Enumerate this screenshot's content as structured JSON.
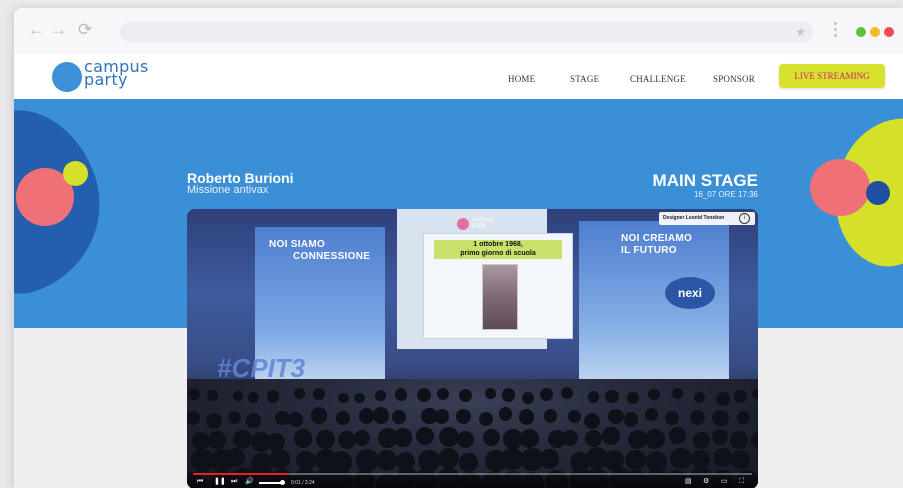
{
  "browser": {
    "nav_back_icon": "←",
    "nav_forward_icon": "→",
    "reload_icon": "⟳",
    "bookmark_icon": "★",
    "window_dots": [
      "#5cc338",
      "#f7b72b",
      "#ee4b4b"
    ]
  },
  "site": {
    "logo_line1": "campus",
    "logo_line2": "party",
    "nav": [
      "HOME",
      "STAGE",
      "CHALLENGE",
      "SPONSOR"
    ],
    "cta": "LIVE STREAMING"
  },
  "event": {
    "speaker": "Roberto Burioni",
    "talk": "Missione antivax",
    "stage": "MAIN STAGE",
    "datetime": "16_07 ORE 17:36"
  },
  "video": {
    "wall_left": [
      "NOI SIAMO",
      "CONNESSIONE"
    ],
    "wall_right": [
      "NOI CREIAMO",
      "IL FUTURO"
    ],
    "slide_caption": [
      "1 ottobre 1968,",
      "primo giorno di scuola"
    ],
    "banner": "#CPIT3",
    "sponsor": "nexi",
    "logo_line1": "campus",
    "logo_line2": "party",
    "info_label": "Designer Leonid Tonebon",
    "info_icon": "i",
    "time_text": "0:01 / 3:24",
    "progress": 0.17,
    "volume": 0.8
  },
  "colors": {
    "brand_blue": "#3b8fd6",
    "lime": "#d5e02a",
    "pink": "#f07078",
    "cta_text": "#d0246c"
  }
}
